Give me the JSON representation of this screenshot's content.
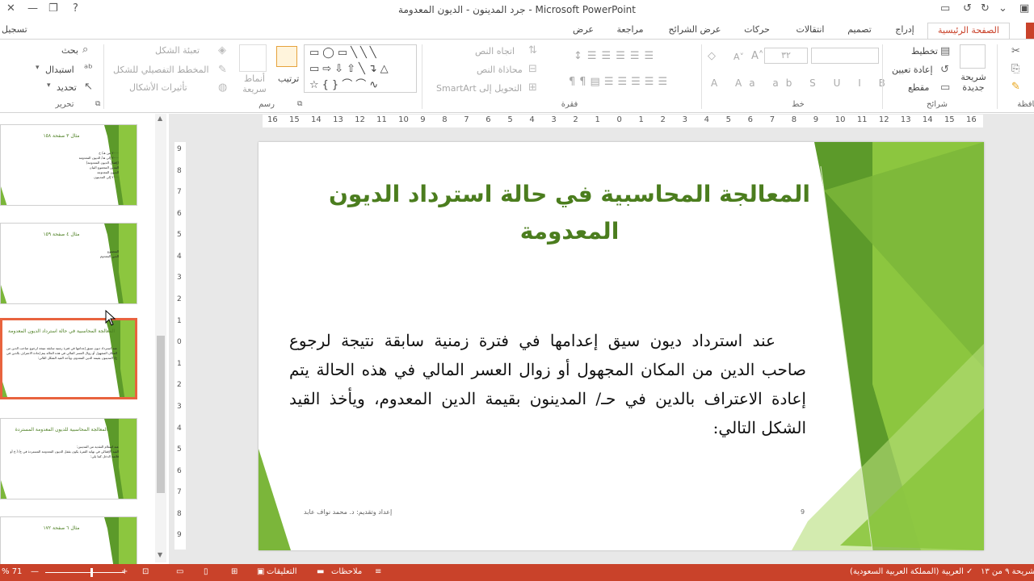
{
  "window": {
    "title": "جرد المدينون - الديون المعدومة - Microsoft PowerPoint",
    "signin": "تسجيل"
  },
  "tabs": [
    {
      "label": "الصفحة الرئيسية",
      "active": true
    },
    {
      "label": "إدراج"
    },
    {
      "label": "تصميم"
    },
    {
      "label": "انتقالات"
    },
    {
      "label": "حركات"
    },
    {
      "label": "عرض الشرائح"
    },
    {
      "label": "مراجعة"
    },
    {
      "label": "عرض"
    }
  ],
  "ribbon": {
    "clipboard_label": "حافظة",
    "slides": {
      "new_slide": "شريحة جديدة",
      "layout": "تخطيط",
      "reset": "إعادة تعيين",
      "section": "مقطع",
      "label": "شرائح"
    },
    "font": {
      "size": "٣٢",
      "label": "خط"
    },
    "paragraph": {
      "text_direction": "اتجاه النص",
      "align_text": "محاذاة النص",
      "smartart": "التحويل إلى SmartArt",
      "label": "فقرة"
    },
    "drawing": {
      "arrange": "ترتيب",
      "quick_styles": "أنماط سريعة",
      "shape_fill": "تعبئة الشكل",
      "shape_outline": "المخطط التفصيلي للشكل",
      "shape_effects": "تأثيرات الأشكال",
      "label": "رسم"
    },
    "editing": {
      "find": "بحث",
      "replace": "استبدال",
      "select": "تحديد",
      "label": "تحرير"
    }
  },
  "thumbnails": [
    {
      "title": "مثال ٣ صفحة ١٥٨",
      "body": "٢٠٠٠ من هـ/ ح\n٢٠٠٠ إلى هـ/ الديون المعدومة\n(إقفال الديون المعدومة)\nالمدين   المجموع   البيان\nالديون المعدومة\n٢٠٠٠ إلى المدينون"
    },
    {
      "title": "مثال ٤ صفحة ١٥٩",
      "body": "المجموع\nالدين المعدوم"
    },
    {
      "title": "المعالجة المحاسبية في حالة استرداد الديون المعدومة",
      "body": "عند استرداد ديون سيق إعدامها في فترة زمنية سابقة نتيجة لرجوع صاحب الدين من المكان المجهول أو زوال العسر المالي في هذه الحالة يتم إعادة الاعتراف بالدين في ح/ المدينون بقيمة الدين المعدوم، ويأخذ القيد الشكل التالي:",
      "selected": true
    },
    {
      "title": "المعالجة المحاسبية للديون المعدومة المستردة",
      "body": "عند استلام النقدية من المدينين:\nالقيد الإقفالي في نهاية الفترة يكون بقفل الديون المعدومة المستردة في ح/ أ.خ أو قائمة الدخل كما يلي:"
    },
    {
      "title": "مثال ٦ صفحة ١٧٢",
      "body": ""
    }
  ],
  "slide": {
    "title": "المعالجة المحاسبية في حالة استرداد الديون المعدومة",
    "body": "عند استرداد ديون سيق إعدامها في فترة زمنية سابقة نتيجة لرجوع صاحب الدين من المكان المجهول أو زوال العسر المالي في هذه الحالة يتم إعادة الاعتراف بالدين في حـ/ المدينون بقيمة الدين المعدوم، ويأخذ القيد الشكل التالي:",
    "footer": "إعداد وتقديم: د. محمد نواف عابد",
    "number": "9"
  },
  "ruler": {
    "h_ticks": [
      "16",
      "15",
      "14",
      "13",
      "12",
      "11",
      "10",
      "9",
      "8",
      "7",
      "6",
      "5",
      "4",
      "3",
      "2",
      "1",
      "0",
      "1",
      "2",
      "3",
      "4",
      "5",
      "6",
      "7",
      "8",
      "9",
      "10",
      "11",
      "12",
      "13",
      "14",
      "15",
      "16"
    ],
    "v_ticks": [
      "9",
      "8",
      "7",
      "6",
      "5",
      "4",
      "3",
      "2",
      "1",
      "0",
      "1",
      "2",
      "3",
      "4",
      "5",
      "6",
      "7",
      "8",
      "9"
    ]
  },
  "statusbar": {
    "slide_info": "الشريحة ٩ من ١٣",
    "language": "العربية (المملكة العربية السعودية)",
    "notes": "ملاحظات",
    "comments": "التعليقات",
    "zoom": "71 %"
  },
  "colors": {
    "accent": "#c9422a",
    "slide_title": "#4b7d1e",
    "green_light": "#8cc63f",
    "green_dark": "#5a9a2a"
  }
}
